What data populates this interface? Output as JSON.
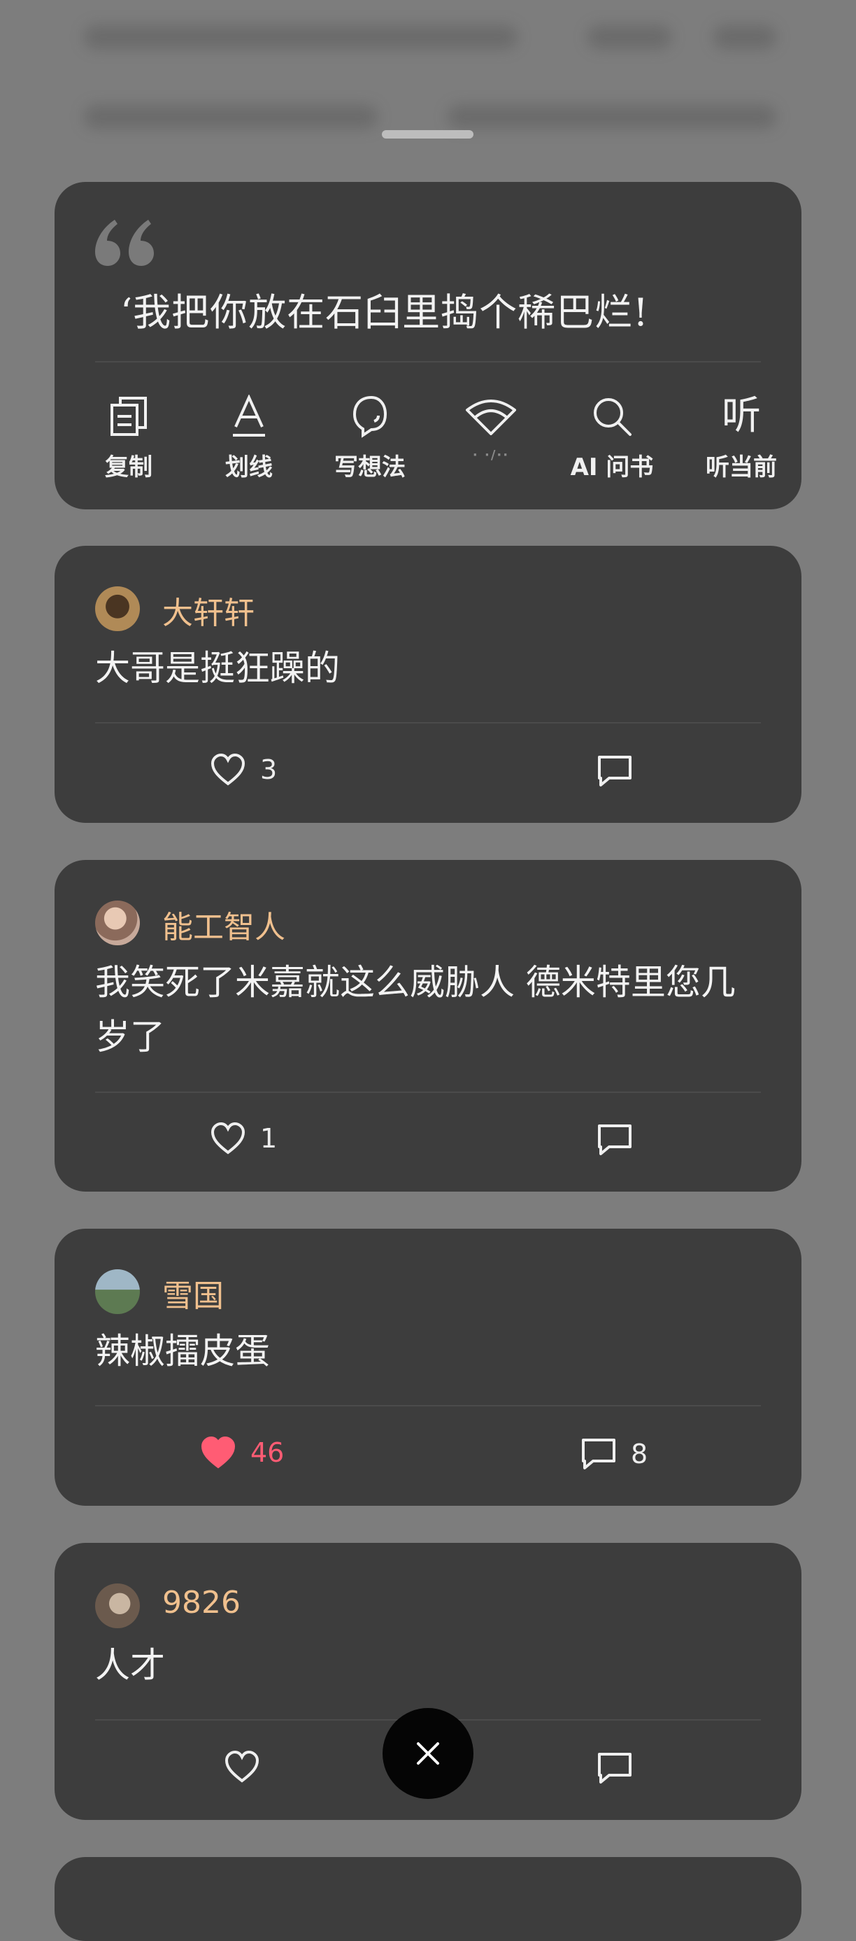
{
  "quote": {
    "text": "‘我把你放在石臼里捣个稀巴烂!",
    "actions": [
      {
        "label": "复制",
        "icon": "copy-icon"
      },
      {
        "label": "划线",
        "icon": "underline-icon"
      },
      {
        "label": "写想法",
        "icon": "idea-bubble-icon"
      },
      {
        "label": "· ·/··",
        "icon": "wifi-share-icon"
      },
      {
        "label": "AI 问书",
        "icon": "search-icon"
      },
      {
        "label": "听当前",
        "icon": "listen-icon"
      }
    ]
  },
  "comments": [
    {
      "user": "大轩轩",
      "text": "大哥是挺狂躁的",
      "likes": "3",
      "liked": false,
      "replies": ""
    },
    {
      "user": "能工智人",
      "text": "我笑死了米嘉就这么威胁人 德米特里您几岁了",
      "likes": "1",
      "liked": false,
      "replies": ""
    },
    {
      "user": "雪国",
      "text": "辣椒擂皮蛋",
      "likes": "46",
      "liked": true,
      "replies": "8"
    },
    {
      "user": "9826",
      "text": "人才",
      "likes": "",
      "liked": false,
      "replies": ""
    }
  ],
  "colors": {
    "username": "#f0c08e",
    "liked": "#ff5c74",
    "card": "#3d3d3d"
  },
  "close": {
    "icon": "close-icon"
  },
  "listen_glyph": "听"
}
